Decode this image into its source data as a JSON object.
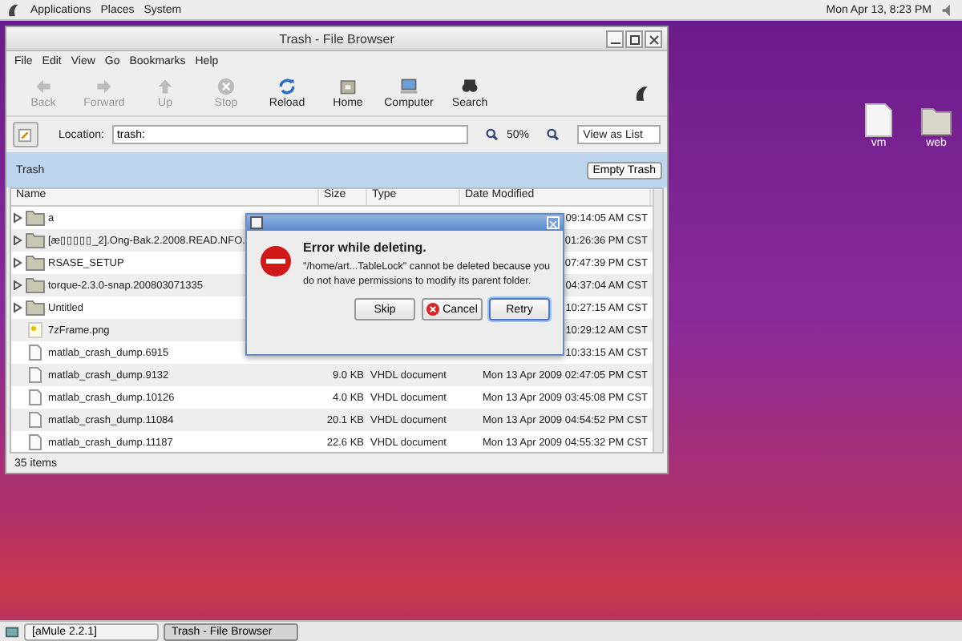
{
  "top_panel": {
    "menus": [
      "Applications",
      "Places",
      "System"
    ],
    "clock": "Mon Apr 13,  8:23 PM"
  },
  "desktop_icons": [
    {
      "label": "vm",
      "kind": "file"
    },
    {
      "label": "web",
      "kind": "folder"
    }
  ],
  "window": {
    "title": "Trash - File Browser",
    "menu": [
      "File",
      "Edit",
      "View",
      "Go",
      "Bookmarks",
      "Help"
    ],
    "toolbar": [
      {
        "label": "Back",
        "kind": "back",
        "disabled": true
      },
      {
        "label": "Forward",
        "kind": "forward",
        "disabled": true
      },
      {
        "label": "Up",
        "kind": "up",
        "disabled": true
      },
      {
        "label": "Stop",
        "kind": "stop",
        "disabled": true
      },
      {
        "label": "Reload",
        "kind": "reload",
        "disabled": false
      },
      {
        "label": "Home",
        "kind": "home",
        "disabled": false
      },
      {
        "label": "Computer",
        "kind": "computer",
        "disabled": false
      },
      {
        "label": "Search",
        "kind": "search",
        "disabled": false
      }
    ],
    "location": {
      "label": "Location:",
      "value": "trash:"
    },
    "zoom": "50%",
    "view": "View as List",
    "trash_bar": {
      "title": "Trash",
      "button": "Empty Trash"
    },
    "table": {
      "columns": [
        "Name",
        "Size",
        "Type",
        "Date Modified"
      ],
      "rows": [
        {
          "kind": "folder",
          "name": "a",
          "size": "",
          "type": "",
          "date": "09:14:05 AM CST"
        },
        {
          "kind": "folder",
          "name": "[æ▯▯▯▯▯_2].Ong-Bak.2.2008.READ.NFO.",
          "size": "",
          "type": "",
          "date": "01:26:36 PM CST"
        },
        {
          "kind": "folder",
          "name": "RSASE_SETUP",
          "size": "",
          "type": "",
          "date": "07:47:39 PM CST"
        },
        {
          "kind": "folder",
          "name": "torque-2.3.0-snap.200803071335",
          "size": "",
          "type": "",
          "date": "04:37:04 AM CST"
        },
        {
          "kind": "folder",
          "name": "Untitled",
          "size": "",
          "type": "",
          "date": "10:27:15 AM CST"
        },
        {
          "kind": "image",
          "name": "7zFrame.png",
          "size": "",
          "type": "",
          "date": "10:29:12 AM CST"
        },
        {
          "kind": "file",
          "name": "matlab_crash_dump.6915",
          "size": "",
          "type": "",
          "date": "10:33:15 AM CST"
        },
        {
          "kind": "file",
          "name": "matlab_crash_dump.9132",
          "size": "9.0 KB",
          "type": "VHDL document",
          "date": "Mon 13 Apr 2009 02:47:05 PM CST"
        },
        {
          "kind": "file",
          "name": "matlab_crash_dump.10126",
          "size": "4.0 KB",
          "type": "VHDL document",
          "date": "Mon 13 Apr 2009 03:45:08 PM CST"
        },
        {
          "kind": "file",
          "name": "matlab_crash_dump.11084",
          "size": "20.1 KB",
          "type": "VHDL document",
          "date": "Mon 13 Apr 2009 04:54:52 PM CST"
        },
        {
          "kind": "file",
          "name": "matlab_crash_dump.11187",
          "size": "22.6 KB",
          "type": "VHDL document",
          "date": "Mon 13 Apr 2009 04:55:32 PM CST"
        }
      ]
    },
    "status": "35 items"
  },
  "dialog": {
    "title": "Error while deleting.",
    "message": "\"/home/art...TableLock\" cannot be deleted because you do not have permissions to modify its parent folder.",
    "buttons": [
      {
        "label": "Skip",
        "kind": "plain",
        "default": false
      },
      {
        "label": "Cancel",
        "kind": "cancel",
        "default": false
      },
      {
        "label": "Retry",
        "kind": "plain",
        "default": true
      }
    ]
  },
  "taskbar": [
    {
      "label": "[aMule 2.2.1]",
      "selected": false
    },
    {
      "label": "Trash - File Browser",
      "selected": true
    }
  ]
}
